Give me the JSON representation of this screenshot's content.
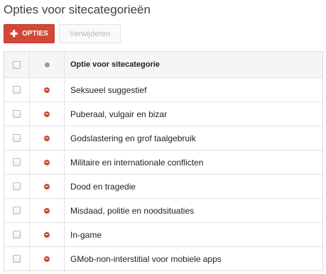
{
  "page": {
    "title": "Opties voor sitecategorieën"
  },
  "toolbar": {
    "add_label": "OPTIES",
    "add_icon": "plus-icon",
    "delete_label": "Verwijderen"
  },
  "colors": {
    "accent": "#d14836",
    "status_blocked": "#d14836",
    "header_bg": "#f5f5f5"
  },
  "table": {
    "header": {
      "name": "Optie voor sitecategorie",
      "status_icon": "status-dot-icon"
    },
    "rows": [
      {
        "name": "Seksueel suggestief",
        "status": "blocked-icon"
      },
      {
        "name": "Puberaal, vulgair en bizar",
        "status": "blocked-icon"
      },
      {
        "name": "Godslastering en grof taalgebruik",
        "status": "blocked-icon"
      },
      {
        "name": "Militaire en internationale conflicten",
        "status": "blocked-icon"
      },
      {
        "name": "Dood en tragedie",
        "status": "blocked-icon"
      },
      {
        "name": "Misdaad, politie en noodsituaties",
        "status": "blocked-icon"
      },
      {
        "name": "In-game",
        "status": "blocked-icon"
      },
      {
        "name": "GMob-non-interstitial voor mobiele apps",
        "status": "blocked-icon"
      }
    ]
  }
}
